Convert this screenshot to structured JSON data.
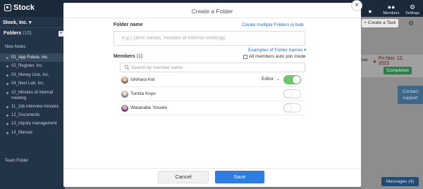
{
  "app": {
    "logo": "Stock"
  },
  "top_nav": [
    {
      "label": "",
      "icon": "notification-icon"
    },
    {
      "label": "Members",
      "icon": "members-icon"
    },
    {
      "label": "Settings",
      "icon": "settings-icon"
    }
  ],
  "sidebar": {
    "company": "Stock, Inc.",
    "company_chevron": "▾",
    "folders_title": "Folders",
    "folders_count": "(10)",
    "add_symbol": "+",
    "new_notes": "New Notes",
    "folders": [
      "01_App Future, Inc.",
      "02_Register, Inc.",
      "03_Money Line, Inc.",
      "04_Next Lab, Inc.",
      "10_Minutes of internal meeting",
      "11_Job interview minutes",
      "12_Documents",
      "13_Inquiry management",
      "14_Manual"
    ],
    "team_folder": "Team Folder"
  },
  "background": {
    "create_task": "+ Create a Task",
    "due_label": "Due",
    "due_date": "Fri Nov. 12, 2021",
    "status": "Completed",
    "contact": "Contact support",
    "messages": "Messages (4)"
  },
  "modal": {
    "title": "Create a Folder",
    "close_symbol": "×",
    "folder_name_label": "Folder name",
    "bulk_link": "Create multiple Folders in bulk",
    "folder_name_placeholder": "e.g.) client names, minutes of internal meetings",
    "folder_name_value": "",
    "examples_link": "Examples of Folder names ▾",
    "members_label": "Members",
    "members_count": "(1)",
    "auto_join_label": "All members auto join mode",
    "search_placeholder": "Search by member name",
    "members": [
      {
        "name": "Ishihara Kei",
        "role": "Editor",
        "joined": true
      },
      {
        "name": "Tomita Koyo",
        "role": "",
        "joined": false
      },
      {
        "name": "Watanabe Yosuke",
        "role": "",
        "joined": false
      }
    ],
    "cancel_label": "Cancel",
    "save_label": "Save"
  },
  "colors": {
    "accent": "#2f7de1",
    "toggle_on": "#6dc76a",
    "sidebar": "#233448",
    "topbar": "#1b2a3a"
  }
}
